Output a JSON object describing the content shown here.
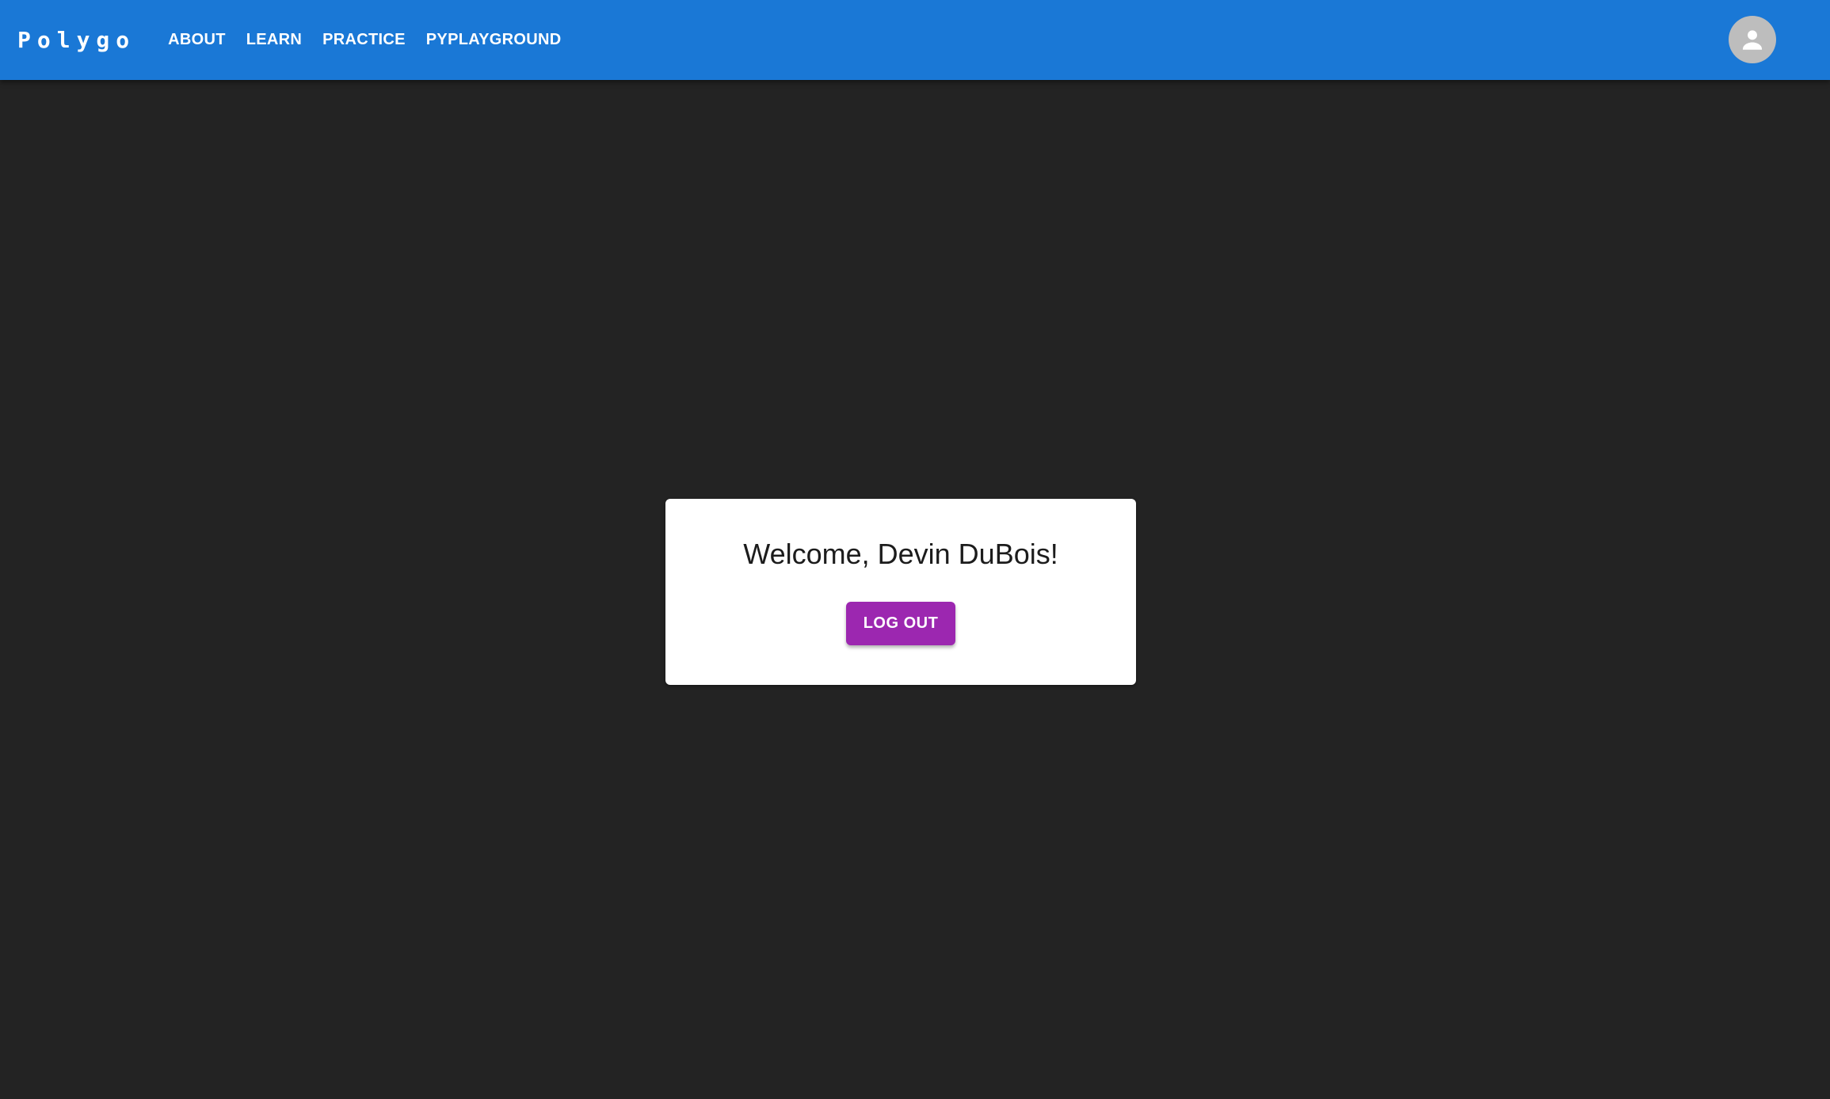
{
  "header": {
    "brand": "Polygo",
    "nav": [
      {
        "label": "ABOUT"
      },
      {
        "label": "LEARN"
      },
      {
        "label": "PRACTICE"
      },
      {
        "label": "PYPLAYGROUND"
      }
    ],
    "account_icon": "account-circle-icon"
  },
  "main": {
    "welcome_text": "Welcome, Devin DuBois!",
    "logout_label": "LOG OUT"
  },
  "colors": {
    "app_bar": "#1a78d6",
    "page_background": "#232323",
    "card_background": "#ffffff",
    "logout_button": "#9c27b0",
    "avatar_background": "#bdbdbd"
  }
}
